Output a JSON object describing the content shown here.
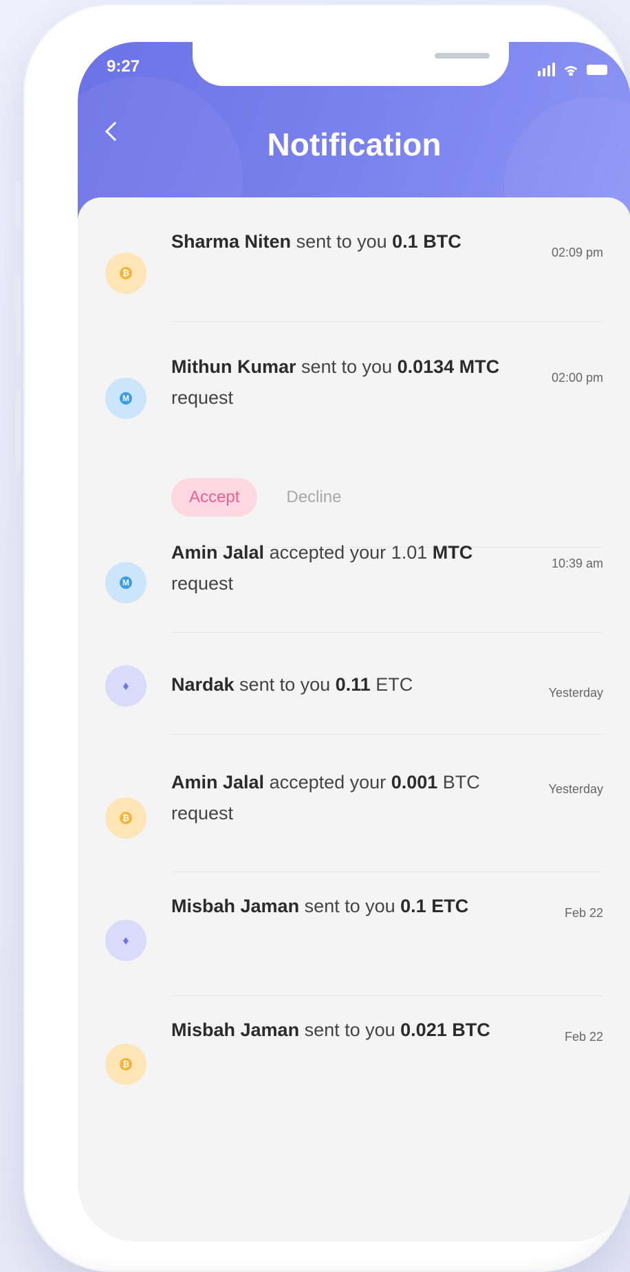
{
  "status_bar": {
    "time": "9:27"
  },
  "header": {
    "title": "Notification"
  },
  "colors": {
    "accent": "#6c74e6",
    "accept_bg": "#fdd8e2",
    "accept_text": "#e8638a"
  },
  "notifications": [
    {
      "icon": "btc-coin-icon",
      "name": "Sharma Niten",
      "text": " sent to you ",
      "amount": "0.1",
      "unit": " BTC",
      "tail": "",
      "time": "02:09 pm"
    },
    {
      "icon": "mtc-coin-icon",
      "name": "Mithun Kumar",
      "text": " sent to you ",
      "amount": "0.0134 MTC",
      "unit": "",
      "tail": " request",
      "time": "02:00 pm",
      "actions": {
        "accept": "Accept",
        "decline": "Decline"
      }
    },
    {
      "icon": "mtc-coin-icon",
      "name": "Amin Jalal",
      "text": " accepted your 1.01 ",
      "amount": "MTC",
      "unit": "",
      "tail": " request",
      "time": "10:39 am"
    },
    {
      "icon": "eth-coin-icon",
      "name": "Nardak",
      "text": " sent to you ",
      "amount": "0.11",
      "unit": " ETC",
      "tail": "",
      "time": "Yesterday"
    },
    {
      "icon": "btc-coin-icon",
      "name": "Amin Jalal",
      "text": " accepted your ",
      "amount": "0.001",
      "unit": " BTC",
      "tail": " request",
      "time": "Yesterday"
    },
    {
      "icon": "eth-coin-icon",
      "name": "Misbah Jaman",
      "text": " sent to you ",
      "amount": "0.1",
      "unit": " ETC",
      "tail": "",
      "time": "Feb 22"
    },
    {
      "icon": "btc-coin-icon",
      "name": "Misbah Jaman",
      "text": " sent to you ",
      "amount": "0.021",
      "unit": " BTC",
      "tail": "",
      "time": "Feb 22"
    }
  ]
}
